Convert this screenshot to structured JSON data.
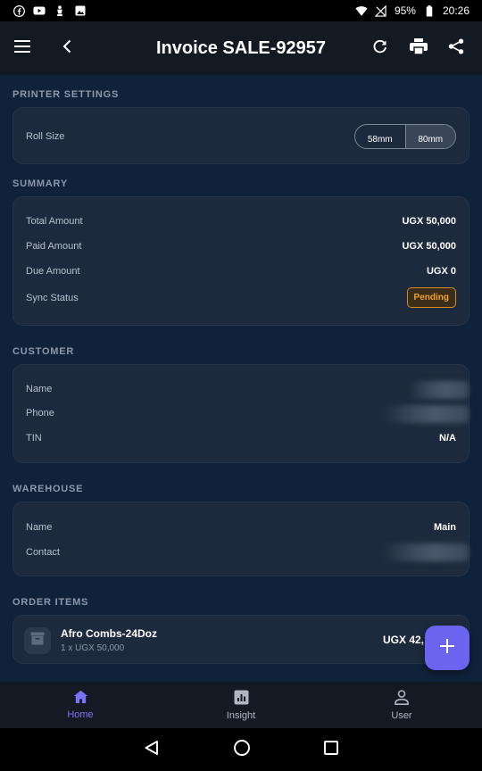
{
  "status_bar": {
    "battery": "95%",
    "time": "20:26",
    "icons_left": [
      "facebook-icon",
      "youtube-icon",
      "bell-icon",
      "image-icon"
    ],
    "icons_right": [
      "wifi-icon",
      "no-signal-icon",
      "battery-icon"
    ]
  },
  "app_bar": {
    "title": "Invoice SALE-92957",
    "icons": [
      "menu-icon",
      "back-icon",
      "refresh-icon",
      "print-icon",
      "share-icon"
    ]
  },
  "printer_settings": {
    "section_title": "PRINTER SETTINGS",
    "roll_size_label": "Roll Size",
    "options": [
      "58mm",
      "80mm"
    ],
    "selected": "80mm"
  },
  "summary": {
    "section_title": "SUMMARY",
    "total_label": "Total Amount",
    "total_value": "UGX 50,000",
    "paid_label": "Paid Amount",
    "paid_value": "UGX 50,000",
    "due_label": "Due Amount",
    "due_value": "UGX 0",
    "sync_label": "Sync Status",
    "sync_value": "Pending",
    "sync_color": "#f0a231"
  },
  "customer": {
    "section_title": "CUSTOMER",
    "name_label": "Name",
    "phone_label": "Phone",
    "tin_label": "TIN",
    "tin_value": "N/A"
  },
  "warehouse": {
    "section_title": "WAREHOUSE",
    "name_label": "Name",
    "name_value": "Main",
    "contact_label": "Contact"
  },
  "order_items": {
    "section_title": "ORDER ITEMS",
    "items": [
      {
        "name": "Afro Combs-24Doz",
        "detail": "1 x UGX 50,000",
        "price": "UGX 42,",
        "icon": "box-icon"
      }
    ]
  },
  "fab": {
    "icon": "plus-icon",
    "color": "#6c63f0"
  },
  "bottom_nav": {
    "items": [
      {
        "label": "Home",
        "icon": "home-icon",
        "active": true
      },
      {
        "label": "Insight",
        "icon": "chart-icon",
        "active": false
      },
      {
        "label": "User",
        "icon": "user-icon",
        "active": false
      }
    ],
    "active_color": "#7b73f5"
  },
  "system_nav": {
    "icons": [
      "back-triangle-icon",
      "home-circle-icon",
      "recents-square-icon"
    ]
  }
}
